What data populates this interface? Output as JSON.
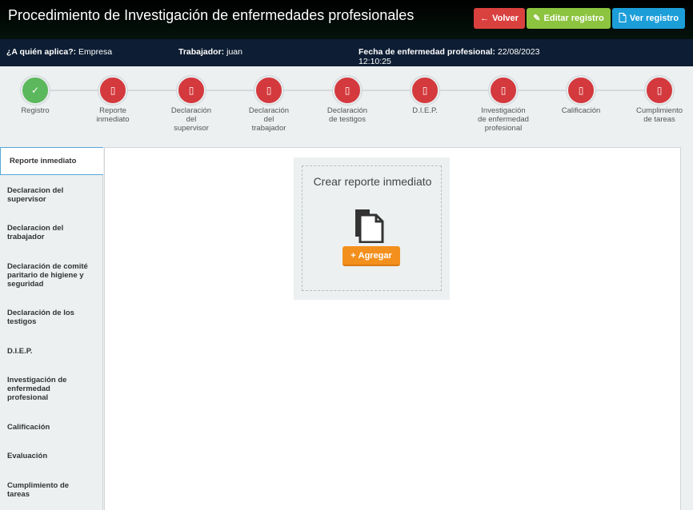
{
  "header": {
    "title": "Procedimiento de Investigación de enfermedades profesionales",
    "buttons": {
      "volver": "Volver",
      "editar": "Editar registro",
      "ver": "Ver registro"
    }
  },
  "info": {
    "aplica_label": "¿A quién aplica?:",
    "aplica_value": "Empresa",
    "trabajador_label": "Trabajador:",
    "trabajador_value": "juan",
    "fecha_label": "Fecha de enfermedad profesional:",
    "fecha_value": "22/08/2023 12:10:25"
  },
  "steps": [
    {
      "label": "Registro",
      "status": "done"
    },
    {
      "label": "Reporte inmediato",
      "status": "pending"
    },
    {
      "label": "Declaración del supervisor",
      "status": "pending"
    },
    {
      "label": "Declaración del trabajador",
      "status": "pending"
    },
    {
      "label": "Declaración de testigos",
      "status": "pending"
    },
    {
      "label": "D.I.E.P.",
      "status": "pending"
    },
    {
      "label": "Investigación de enfermedad profesional",
      "status": "pending"
    },
    {
      "label": "Calificación",
      "status": "pending"
    },
    {
      "label": "Cumplimiento de tareas",
      "status": "pending"
    }
  ],
  "sidebar": {
    "items": [
      {
        "label": "Reporte inmediato"
      },
      {
        "label": "Declaracion del supervisor"
      },
      {
        "label": "Declaracion del trabajador"
      },
      {
        "label": "Declaración de comité paritario de higiene y seguridad"
      },
      {
        "label": "Declaración de los testigos"
      },
      {
        "label": "D.I.E.P."
      },
      {
        "label": "Investigación de enfermedad profesional"
      },
      {
        "label": "Calificación"
      },
      {
        "label": "Evaluación"
      },
      {
        "label": "Cumplimiento de tareas"
      }
    ]
  },
  "card": {
    "title": "Crear reporte inmediato",
    "add_label": "Agregar"
  },
  "colors": {
    "done": "#5cb85c",
    "pending": "#d4393d",
    "accent": "#f3901d"
  }
}
